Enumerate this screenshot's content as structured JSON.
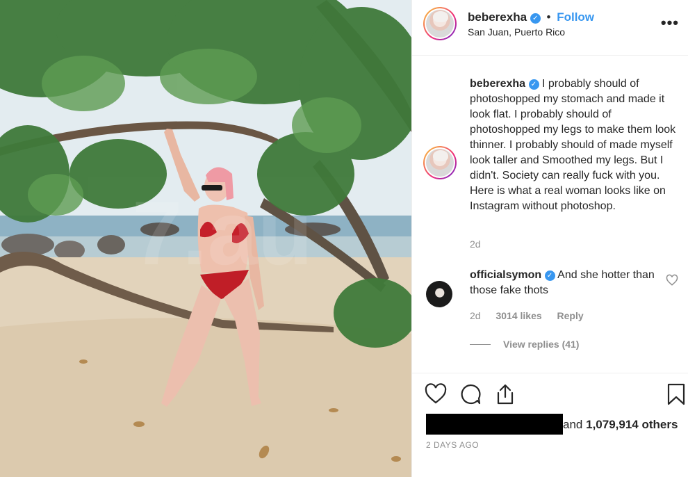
{
  "post": {
    "author": "beberexha",
    "follow_label": "Follow",
    "separator": "•",
    "location": "San Juan, Puerto Rico",
    "more_label": "•••",
    "verified_glyph": "✓"
  },
  "caption": {
    "author": "beberexha",
    "text": "I probably should of photoshopped my stomach and made it look flat. I probably should of photoshopped my legs to make them look thinner. I probably should of made myself look taller and Smoothed my legs. But I didn't. Society can really fuck with you. Here is what a real woman looks like on Instagram without photoshop.",
    "age": "2d"
  },
  "comment": {
    "author": "officialsymon",
    "text": "And she hotter than those fake thots",
    "age": "2d",
    "likes": "3014 likes",
    "reply_label": "Reply",
    "view_replies": "View replies (41)"
  },
  "engagement": {
    "likes_suffix_prefix": "and",
    "likes_count": "1,079,914 others",
    "timestamp": "2 DAYS AGO"
  },
  "icons": {
    "like": "heart-icon",
    "comment": "comment-bubble-icon",
    "share": "share-icon",
    "save": "bookmark-icon"
  },
  "colors": {
    "link": "#3897f0",
    "muted": "#8e8e8e",
    "text": "#262626"
  }
}
